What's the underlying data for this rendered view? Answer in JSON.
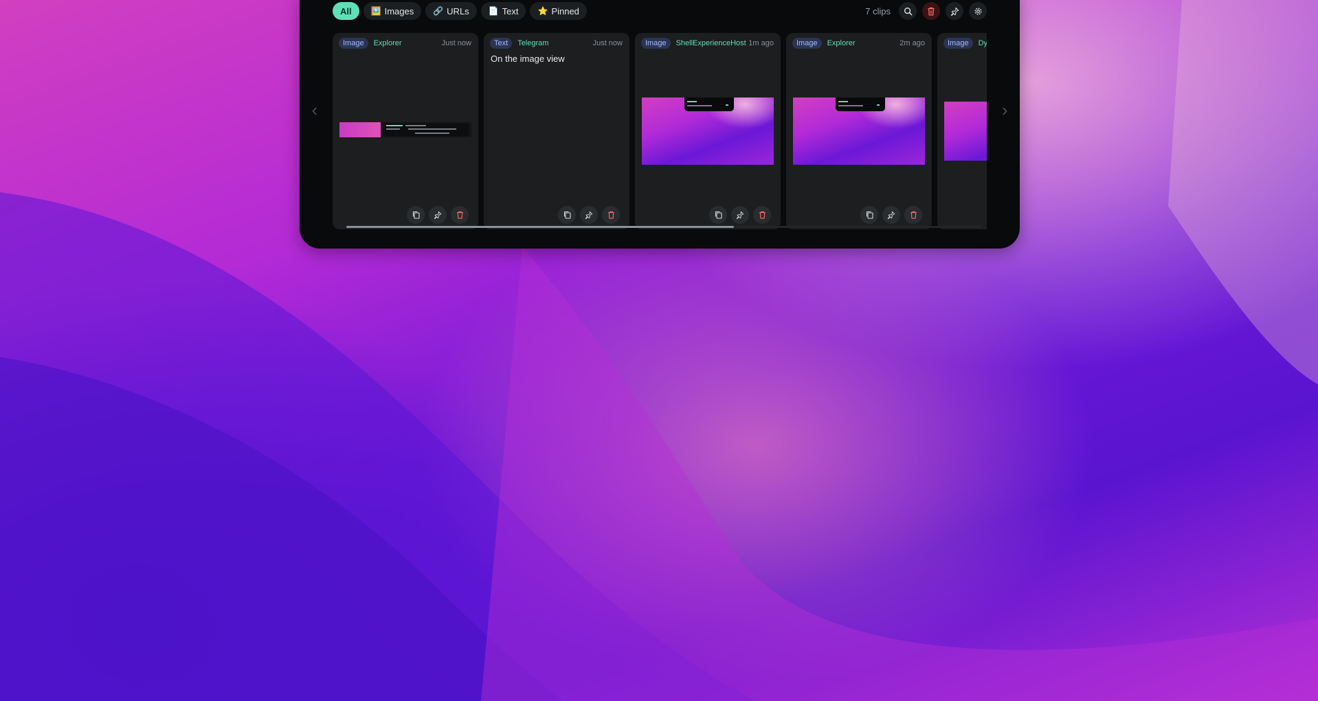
{
  "filters": [
    {
      "label": "All",
      "emoji": ""
    },
    {
      "label": "Images",
      "emoji": "🖼️"
    },
    {
      "label": "URLs",
      "emoji": "🔗"
    },
    {
      "label": "Text",
      "emoji": "📄"
    },
    {
      "label": "Pinned",
      "emoji": "⭐"
    }
  ],
  "toolbar": {
    "count_label": "7 clips",
    "icons": [
      "search-icon",
      "trash-icon",
      "pin-icon",
      "gear-icon"
    ]
  },
  "clips": [
    {
      "type": "Image",
      "source": "Explorer",
      "time": "Just now"
    },
    {
      "type": "Text",
      "source": "Telegram",
      "time": "Just now",
      "text": "On the image view"
    },
    {
      "type": "Image",
      "source": "ShellExperienceHost",
      "time": "1m ago"
    },
    {
      "type": "Image",
      "source": "Explorer",
      "time": "2m ago"
    },
    {
      "type": "Image",
      "source": "Dy",
      "time": ""
    }
  ],
  "scroll": {
    "visible_fraction": 0.61
  },
  "colors": {
    "accent": "#5ee0b6",
    "panel": "#080a0b",
    "card": "#1c1e20",
    "badge_text": "#a7b8ff",
    "danger": "#ff6b6b"
  }
}
